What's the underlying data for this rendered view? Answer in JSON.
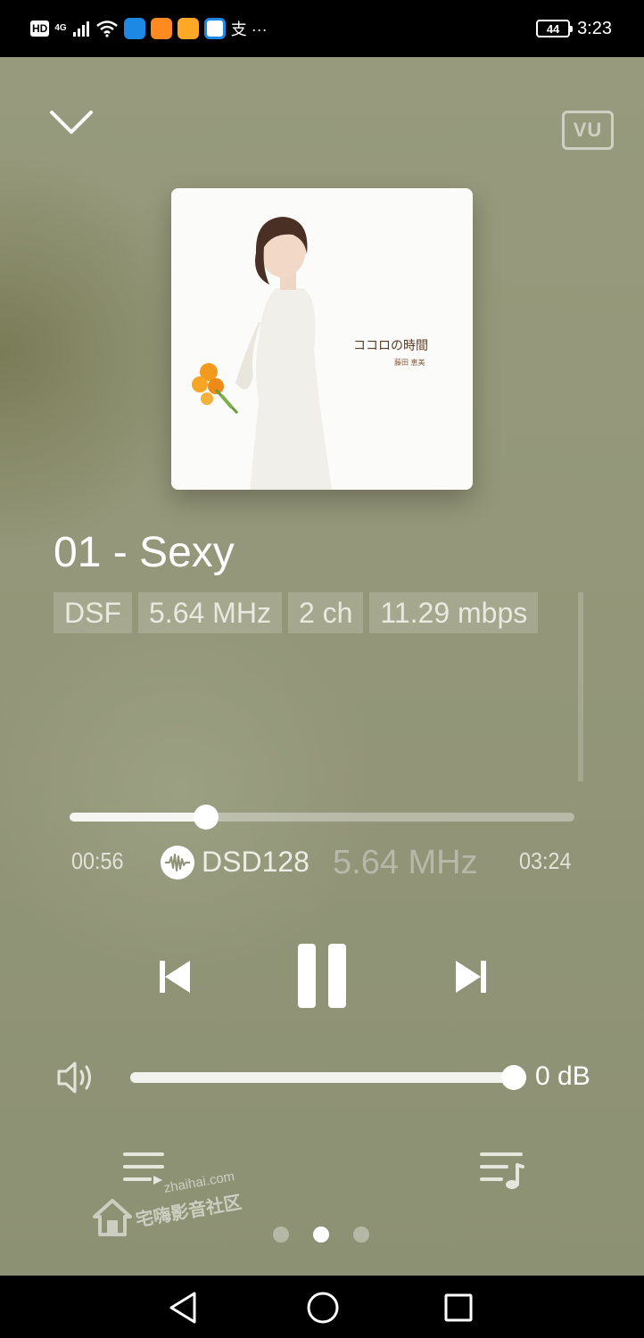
{
  "status_bar": {
    "hd_badge": "HD",
    "network": "4G",
    "extra_text": "支 ···",
    "battery": "44",
    "time": "3:23"
  },
  "header": {
    "vu_label": "VU",
    "collapse_icon": "chevron-down-icon"
  },
  "album": {
    "title": "ココロの時間",
    "artist": "藤田 恵美"
  },
  "track": {
    "title": "01 - Sexy"
  },
  "format_chips": [
    "DSF",
    "5.64 MHz",
    "2 ch",
    "11.29 mbps"
  ],
  "playback": {
    "elapsed": "00:56",
    "total": "03:24",
    "progress": 0.27,
    "format_label": "DSD128",
    "sample_rate": "5.64 MHz",
    "state": "playing"
  },
  "volume": {
    "level": 1.0,
    "label": "0 dB"
  },
  "pager": {
    "count": 3,
    "active": 1
  },
  "watermark": {
    "url": "zhaihai.com",
    "text": "宅嗨影音社区"
  },
  "colors": {
    "background": "#949779",
    "accent": "#ffffff"
  }
}
